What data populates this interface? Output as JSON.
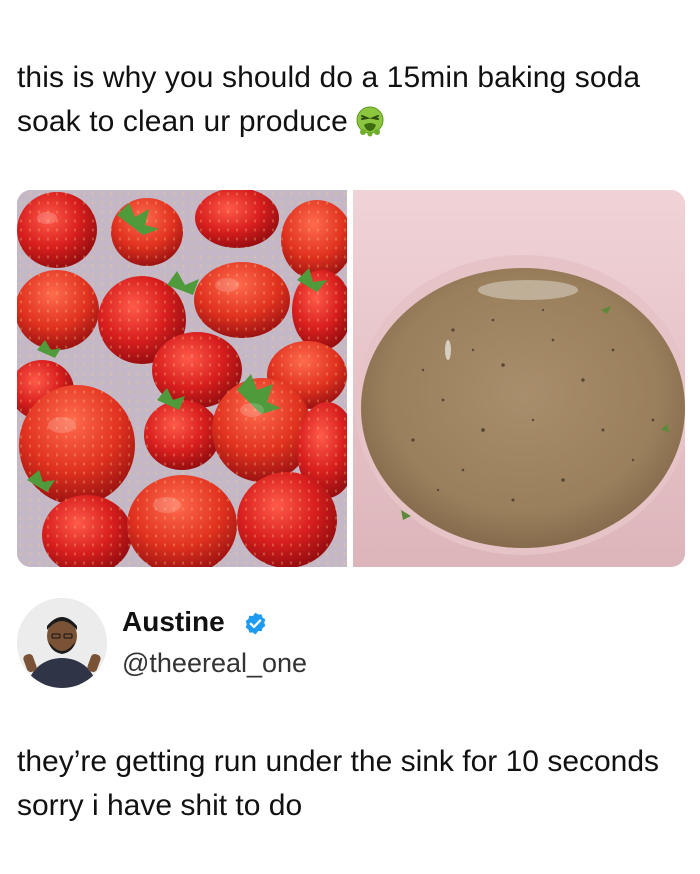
{
  "post": {
    "caption": "this is why you should do a 15min baking soda soak to clean ur produce",
    "caption_emoji": "nauseated-face-icon"
  },
  "images": {
    "left": "strawberries-soaking-photo",
    "right": "dirty-soak-water-bowl-photo"
  },
  "tweet": {
    "author_name": "Austine",
    "author_handle": "@theereal_one",
    "verified": true,
    "text": "they’re getting run under the sink for 10 seconds sorry i have shit to do"
  },
  "colors": {
    "verified_badge": "#1d9bf0",
    "text": "#111111",
    "background": "#ffffff"
  }
}
